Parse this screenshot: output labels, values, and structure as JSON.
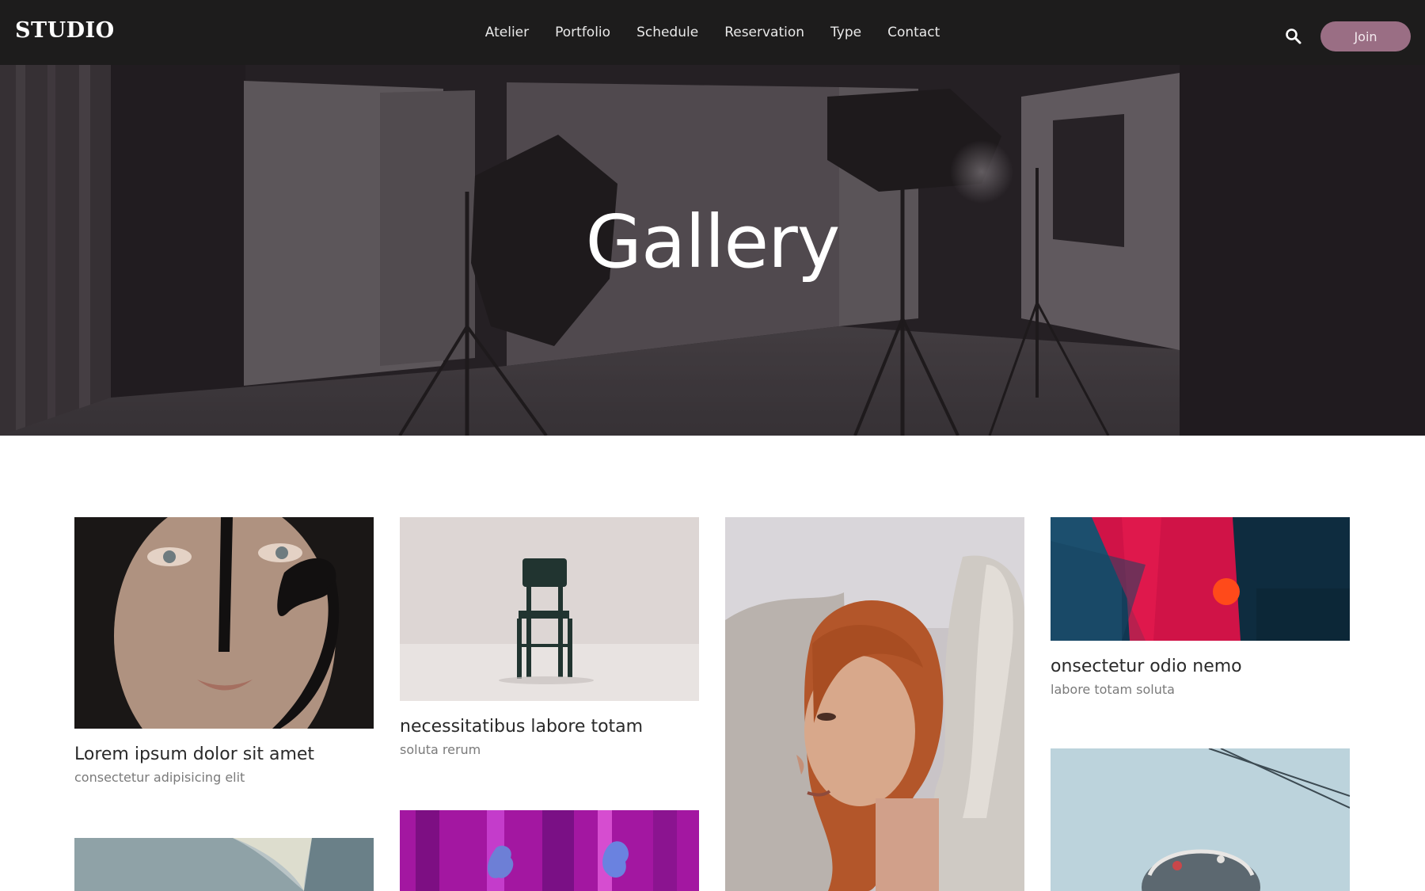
{
  "brand": {
    "logo": "STUDIO"
  },
  "nav": {
    "items": [
      {
        "label": "Atelier"
      },
      {
        "label": "Portfolio"
      },
      {
        "label": "Schedule"
      },
      {
        "label": "Reservation"
      },
      {
        "label": "Type"
      },
      {
        "label": "Contact"
      }
    ],
    "search_icon": "search-icon",
    "join_label": "Join"
  },
  "hero": {
    "title": "Gallery"
  },
  "gallery": {
    "cards": [
      {
        "title": "Lorem ipsum dolor sit amet",
        "subtitle": "consectetur adipisicing elit",
        "image": "painted-face-portrait"
      },
      {
        "title": "necessitatibus labore totam",
        "subtitle": "soluta rerum",
        "image": "green-chair"
      },
      {
        "image": "red-haired-woman-with-statue"
      },
      {
        "title": "onsectetur odio nemo",
        "subtitle": "labore totam soluta",
        "image": "abstract-paint-red-blue"
      },
      {
        "image": "curved-light-architecture"
      },
      {
        "image": "magenta-abstract-texture"
      },
      {
        "image": "sculpture-head-sky"
      }
    ]
  },
  "colors": {
    "navbar_bg": "#1d1c1c",
    "join_button": "#9a6e84",
    "text_dark": "#2a2a2a",
    "text_muted": "#7a7a7a"
  }
}
